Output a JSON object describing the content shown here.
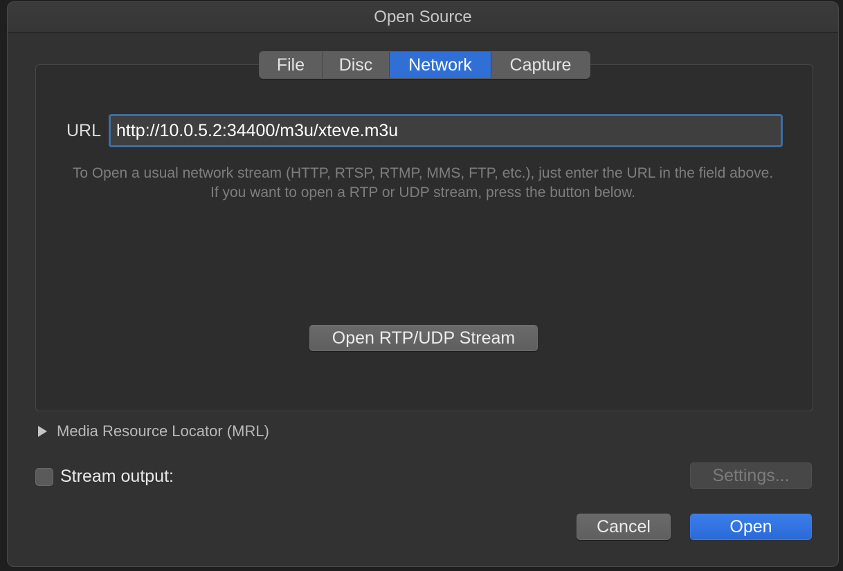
{
  "window": {
    "title": "Open Source"
  },
  "tabs": [
    {
      "label": "File",
      "active": false
    },
    {
      "label": "Disc",
      "active": false
    },
    {
      "label": "Network",
      "active": true
    },
    {
      "label": "Capture",
      "active": false
    }
  ],
  "network": {
    "url_label": "URL",
    "url_value": "http://10.0.5.2:34400/m3u/xteve.m3u",
    "help_text": "To Open a usual network stream (HTTP, RTSP, RTMP, MMS, FTP, etc.), just enter the URL in the field above. If you want to open a RTP or UDP stream, press the button below.",
    "rtp_button": "Open RTP/UDP Stream"
  },
  "mrl": {
    "label": "Media Resource Locator (MRL)",
    "expanded": false
  },
  "stream_output": {
    "label": "Stream output:",
    "checked": false,
    "settings_button": "Settings...",
    "settings_enabled": false
  },
  "footer": {
    "cancel_label": "Cancel",
    "open_label": "Open"
  },
  "colors": {
    "accent": "#2f6fd6",
    "window_bg": "#323232",
    "focus_ring": "#3e6ea4"
  }
}
